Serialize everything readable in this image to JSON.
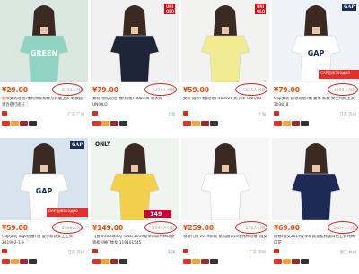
{
  "products": [
    {
      "price": "¥29.00",
      "sales": "8733人付款",
      "title_hl": "夏季",
      "title": "女装短袖T恤纯棉宽松修身韩版上衣 新款圆领百搭打底衫",
      "shop": "",
      "location": "广东 广州",
      "logo": "",
      "shirt_color": "#8fd3c2",
      "shirt_text": "GREEN"
    },
    {
      "price": "¥79.00",
      "sales": "5479人付款",
      "title_hl": "",
      "title": "女装 雪纺短袖T恤(短袖) 408795 优衣库 UNIQLO",
      "shop": "",
      "location": "上海",
      "logo": "UNI QLO",
      "shirt_color": "#1f2538",
      "shirt_text": ""
    },
    {
      "price": "¥59.00",
      "sales": "5835人付款",
      "title_hl": "",
      "title": "女装 圆领T恤(短袖) 409026 优衣库 UNIQLO",
      "shop": "",
      "location": "上海",
      "logo": "UNI QLO",
      "shirt_color": "#f1ec91",
      "shirt_text": ""
    },
    {
      "price": "¥79.00",
      "sales": "4909人付款",
      "title_hl": "",
      "title": "Gap女装 圆领短袖T恤 夏季 新款 女士纯棉上衣 303818",
      "shop": "",
      "location": "江苏 苏州",
      "logo": "GAP",
      "shirt_color": "#ffffff",
      "shirt_text": "GAP"
    },
    {
      "price": "¥59.00",
      "sales": "2098人付款",
      "title_hl": "",
      "title": "Gap女装 logo短袖T恤 夏季新款女士上衣 241902-1 9",
      "shop": "",
      "location": "江苏 苏州",
      "logo": "GAP",
      "shirt_color": "#ffffff",
      "shirt_text": "GAP"
    },
    {
      "price": "¥149.00",
      "sales": "1249人付款",
      "title_hl": "",
      "title": "【直降300减30】ONLY2019夏季新款纯棉印花宽松短袖T恤女 119101545",
      "shop": "",
      "location": "天津",
      "logo": "ONLY",
      "shirt_color": "#f2d04a",
      "shirt_text": "",
      "price_tag": "149"
    },
    {
      "price": "¥259.00",
      "sales": "270人付款",
      "title_hl": "",
      "title": "香港代购 2019新款 宽松圆领印花纯棉短袖T恤女",
      "shop": "",
      "location": "广东 深圳",
      "logo": "",
      "shirt_color": "#ffffff",
      "shirt_text": ""
    },
    {
      "price": "¥69.00",
      "sales": "560+人付款",
      "title_hl": "",
      "title": "短袖t恤女2019夏季新款宽松韩版白色上衣纯棉印花",
      "shop": "",
      "location": "浙江 杭州",
      "logo": "",
      "shirt_color": "#1e2a55",
      "shirt_text": ""
    }
  ],
  "promo_text": "GAP直降300减30",
  "colors": {
    "price": "#ff4400",
    "circle": "#e0201b"
  }
}
